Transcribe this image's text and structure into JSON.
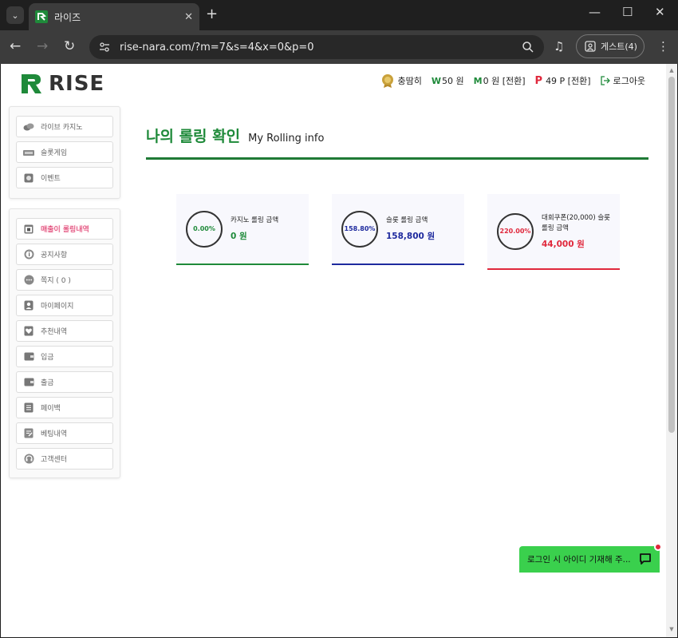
{
  "browser": {
    "tab_title": "라이즈",
    "url": "rise-nara.com/?m=7&s=4&x=0&p=0",
    "profile_label": "게스트(4)"
  },
  "header": {
    "logo_text": "RISE",
    "username": "충땀히",
    "won_symbol": "W",
    "balance": "50 원",
    "m_symbol": "M",
    "m_balance": "0 원 [전환]",
    "p_symbol": "P",
    "points": "49 P [전환]",
    "logout_label": "로그아웃"
  },
  "sidebar": {
    "top_items": [
      {
        "label": "라이브 카지노",
        "icon": "chip-icon"
      },
      {
        "label": "슬롯게임",
        "icon": "slot-icon"
      },
      {
        "label": "이벤트",
        "icon": "event-icon"
      }
    ],
    "bottom_items": [
      {
        "label": "매출이 롤링내역",
        "icon": "calendar-icon"
      },
      {
        "label": "공지사항",
        "icon": "info-icon"
      },
      {
        "label": "쪽지 ( 0 )",
        "icon": "message-icon"
      },
      {
        "label": "마이페이지",
        "icon": "user-icon"
      },
      {
        "label": "추천내역",
        "icon": "heart-icon"
      },
      {
        "label": "입금",
        "icon": "deposit-icon"
      },
      {
        "label": "출금",
        "icon": "withdraw-icon"
      },
      {
        "label": "페이백",
        "icon": "payback-icon"
      },
      {
        "label": "베팅내역",
        "icon": "betting-icon"
      },
      {
        "label": "고객센터",
        "icon": "support-icon"
      }
    ]
  },
  "main": {
    "title_ko": "나의 롤링 확인",
    "title_en": "My Rolling info",
    "cards": [
      {
        "percent": "0.00%",
        "label": "카지노 롤링 금액",
        "amount": "0 원",
        "color": "#1f8a3a"
      },
      {
        "percent": "158.80%",
        "label": "슬롯 롤링 금액",
        "amount": "158,800 원",
        "color": "#1e2a9e"
      },
      {
        "percent": "220.00%",
        "label": "대회쿠폰(20,000) 슬롯 롤링 금액",
        "amount": "44,000 원",
        "color": "#e0283c"
      }
    ]
  },
  "chat": {
    "text": "로그인 시 아이디 기재해 주..."
  },
  "colors": {
    "brand_green": "#1f8a3a",
    "slot_blue": "#1e2a9e",
    "coupon_red": "#e0283c",
    "chat_green": "#3ad04d"
  }
}
